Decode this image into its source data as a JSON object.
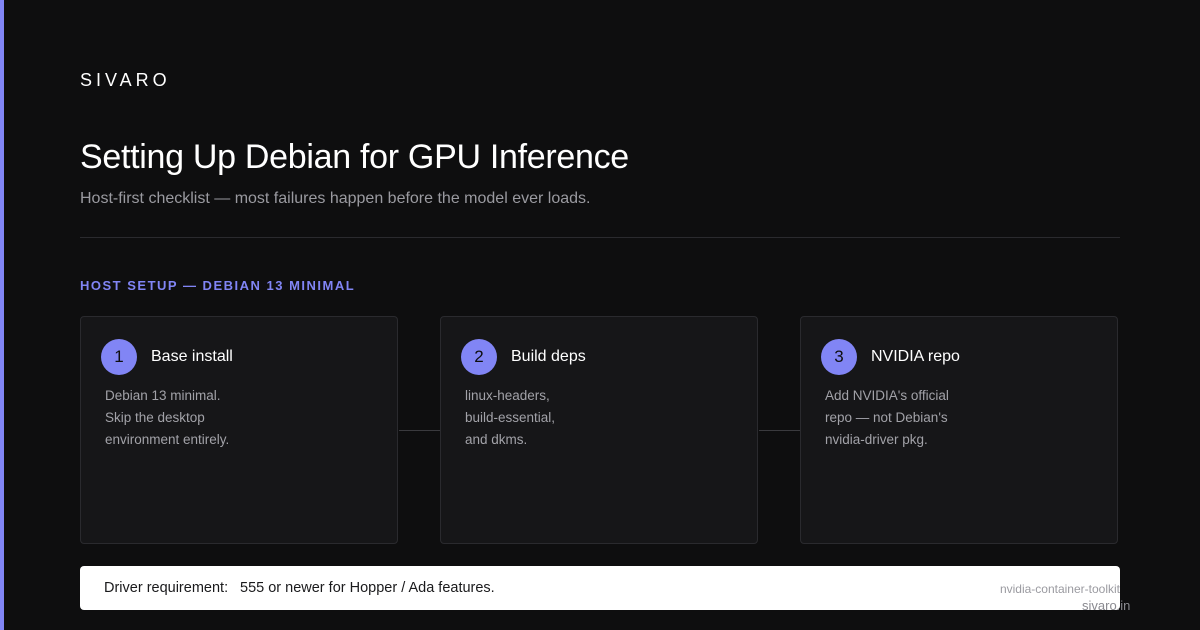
{
  "brand": "SIVARO",
  "title": "Setting Up Debian for GPU Inference",
  "subtitle": "Host-first checklist — most failures happen before the model ever loads.",
  "section_label": "HOST SETUP — DEBIAN 13 MINIMAL",
  "colors": {
    "background": "#0e0e0f",
    "accent": "#8185f5",
    "card": "#161618",
    "card_border": "#2a2a2e",
    "muted_text": "#9a9aa0"
  },
  "steps": [
    {
      "number": "1",
      "title": "Base install",
      "lines": [
        "Debian 13 minimal.",
        "Skip the desktop",
        "environment entirely."
      ]
    },
    {
      "number": "2",
      "title": "Build deps",
      "lines": [
        "linux-headers,",
        "build-essential,",
        "and dkms."
      ]
    },
    {
      "number": "3",
      "title": "NVIDIA repo",
      "lines": [
        "Add NVIDIA's official",
        "repo — not Debian's",
        "nvidia-driver pkg."
      ]
    }
  ],
  "note": {
    "label": "Driver requirement:",
    "value": "555 or newer for Hopper / Ada features.",
    "tag": "nvidia-container-toolkit"
  },
  "footer_url": "sivaro.in"
}
